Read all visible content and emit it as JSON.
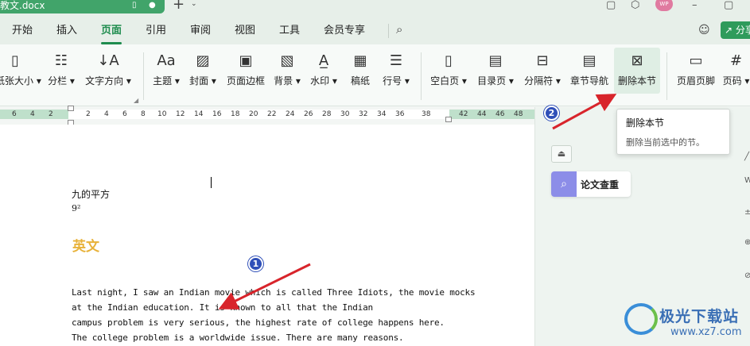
{
  "titlebar": {
    "doc_name": "教文.docx",
    "plus": "+",
    "caret": "⌄",
    "avatar": "WP"
  },
  "menu": {
    "items": [
      "开始",
      "插入",
      "页面",
      "引用",
      "审阅",
      "视图",
      "工具",
      "会员专享"
    ],
    "active": "页面",
    "share": "分享"
  },
  "ribbon": {
    "buttons": [
      {
        "label": "纸张大小 ▾",
        "icon": "paper-size-icon"
      },
      {
        "label": "分栏 ▾",
        "icon": "columns-icon"
      },
      {
        "label": "文字方向 ▾",
        "icon": "text-direction-icon"
      },
      {
        "label": "主题 ▾",
        "icon": "theme-icon"
      },
      {
        "label": "封面 ▾",
        "icon": "cover-icon"
      },
      {
        "label": "页面边框",
        "icon": "page-border-icon"
      },
      {
        "label": "背景 ▾",
        "icon": "background-icon"
      },
      {
        "label": "水印 ▾",
        "icon": "watermark-icon"
      },
      {
        "label": "稿纸",
        "icon": "manuscript-paper-icon"
      },
      {
        "label": "行号 ▾",
        "icon": "line-number-icon"
      },
      {
        "label": "空白页 ▾",
        "icon": "blank-page-icon"
      },
      {
        "label": "目录页 ▾",
        "icon": "toc-page-icon"
      },
      {
        "label": "分隔符 ▾",
        "icon": "separator-icon"
      },
      {
        "label": "章节导航",
        "icon": "section-nav-icon"
      },
      {
        "label": "删除本节",
        "icon": "delete-section-icon"
      },
      {
        "label": "页眉页脚",
        "icon": "header-footer-icon"
      },
      {
        "label": "页码 ▾",
        "icon": "page-number-icon"
      }
    ]
  },
  "ruler": {
    "labels": [
      "6",
      "4",
      "2",
      "2",
      "4",
      "6",
      "8",
      "10",
      "12",
      "14",
      "16",
      "18",
      "20",
      "22",
      "24",
      "26",
      "28",
      "30",
      "32",
      "34",
      "36",
      "38",
      "42",
      "44",
      "46",
      "48"
    ]
  },
  "document": {
    "line1": "九的平方",
    "line2": "9²",
    "heading": "英文",
    "paragraph": [
      "Last night, I saw an Indian movie which is called Three Idiots, the movie mocks",
      "at the Indian education. It is known to all that the Indian",
      "campus problem is very serious, the highest rate of college happens here.",
      "The college problem is a worldwide issue. There are many reasons."
    ]
  },
  "sidepanel": {
    "collapse": "⏏",
    "paper_check": "论文查重"
  },
  "tooltip": {
    "title": "删除本节",
    "desc": "删除当前选中的节。"
  },
  "annotations": {
    "badge1": "1",
    "badge2": "2",
    "color": "#d8242b"
  },
  "watermark": {
    "cn": "极光下载站",
    "url": "www.xz7.com"
  }
}
